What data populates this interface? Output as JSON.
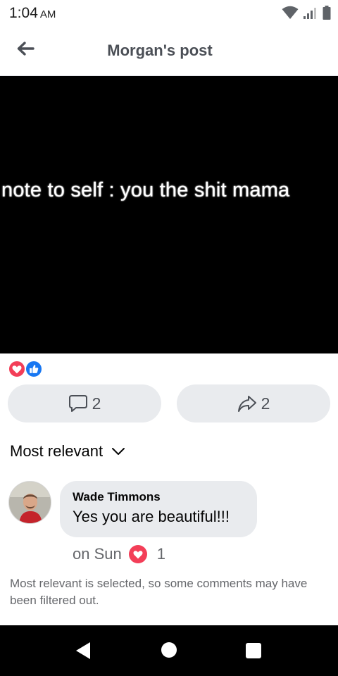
{
  "status_bar": {
    "time": "1:04",
    "ampm": "AM",
    "icons": [
      "wifi-icon",
      "cell-signal-icon",
      "battery-icon"
    ]
  },
  "header": {
    "title": "Morgan's post",
    "back_icon": "arrow-left-icon"
  },
  "post": {
    "image_text": "note to self : you the shit mama",
    "reactions": [
      "love",
      "like"
    ]
  },
  "actions": {
    "comment_count": "2",
    "share_count": "2"
  },
  "comments": {
    "sort_label": "Most relevant",
    "items": [
      {
        "author": "Wade Timmons",
        "text": "Yes you are beautiful!!!",
        "time": "on Sun",
        "reaction_count": "1"
      }
    ],
    "filter_notice": "Most relevant is selected, so some comments may have been filtered out."
  },
  "colors": {
    "love": "#f33e58",
    "like": "#1877f2",
    "pill_bg": "#e9ebee",
    "muted_text": "#65676b"
  }
}
